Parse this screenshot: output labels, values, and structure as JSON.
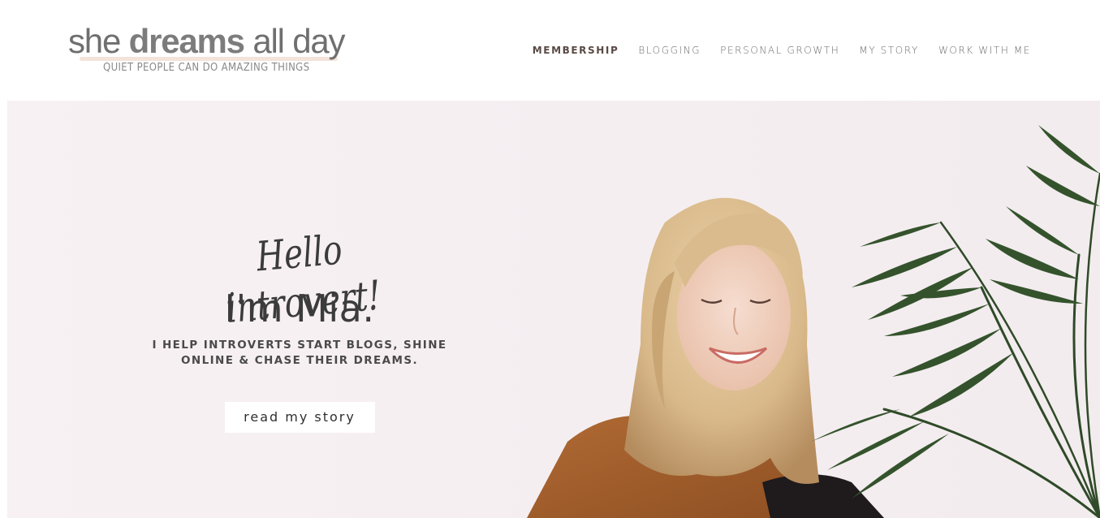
{
  "logo": {
    "word_she": "she",
    "word_dreams": "dreams",
    "word_all_day": "all day",
    "tagline": "QUIET PEOPLE CAN DO AMAZING THINGS"
  },
  "nav": {
    "items": [
      {
        "label": "MEMBERSHIP",
        "active": true
      },
      {
        "label": "BLOGGING",
        "active": false
      },
      {
        "label": "PERSONAL GROWTH",
        "active": false
      },
      {
        "label": "MY STORY",
        "active": false
      },
      {
        "label": "WORK WITH ME",
        "active": false
      }
    ]
  },
  "hero": {
    "script_greeting": "Hello introvert!",
    "name_line": "I'm Mia.",
    "tagline_line1": "I HELP INTROVERTS START BLOGS, SHINE",
    "tagline_line2": "ONLINE & CHASE THEIR DREAMS.",
    "button_label": "read my story"
  },
  "colors": {
    "accent": "#f5dfd2",
    "hero_background": "#f7f0f2",
    "text_dark": "#3c3c3c"
  }
}
